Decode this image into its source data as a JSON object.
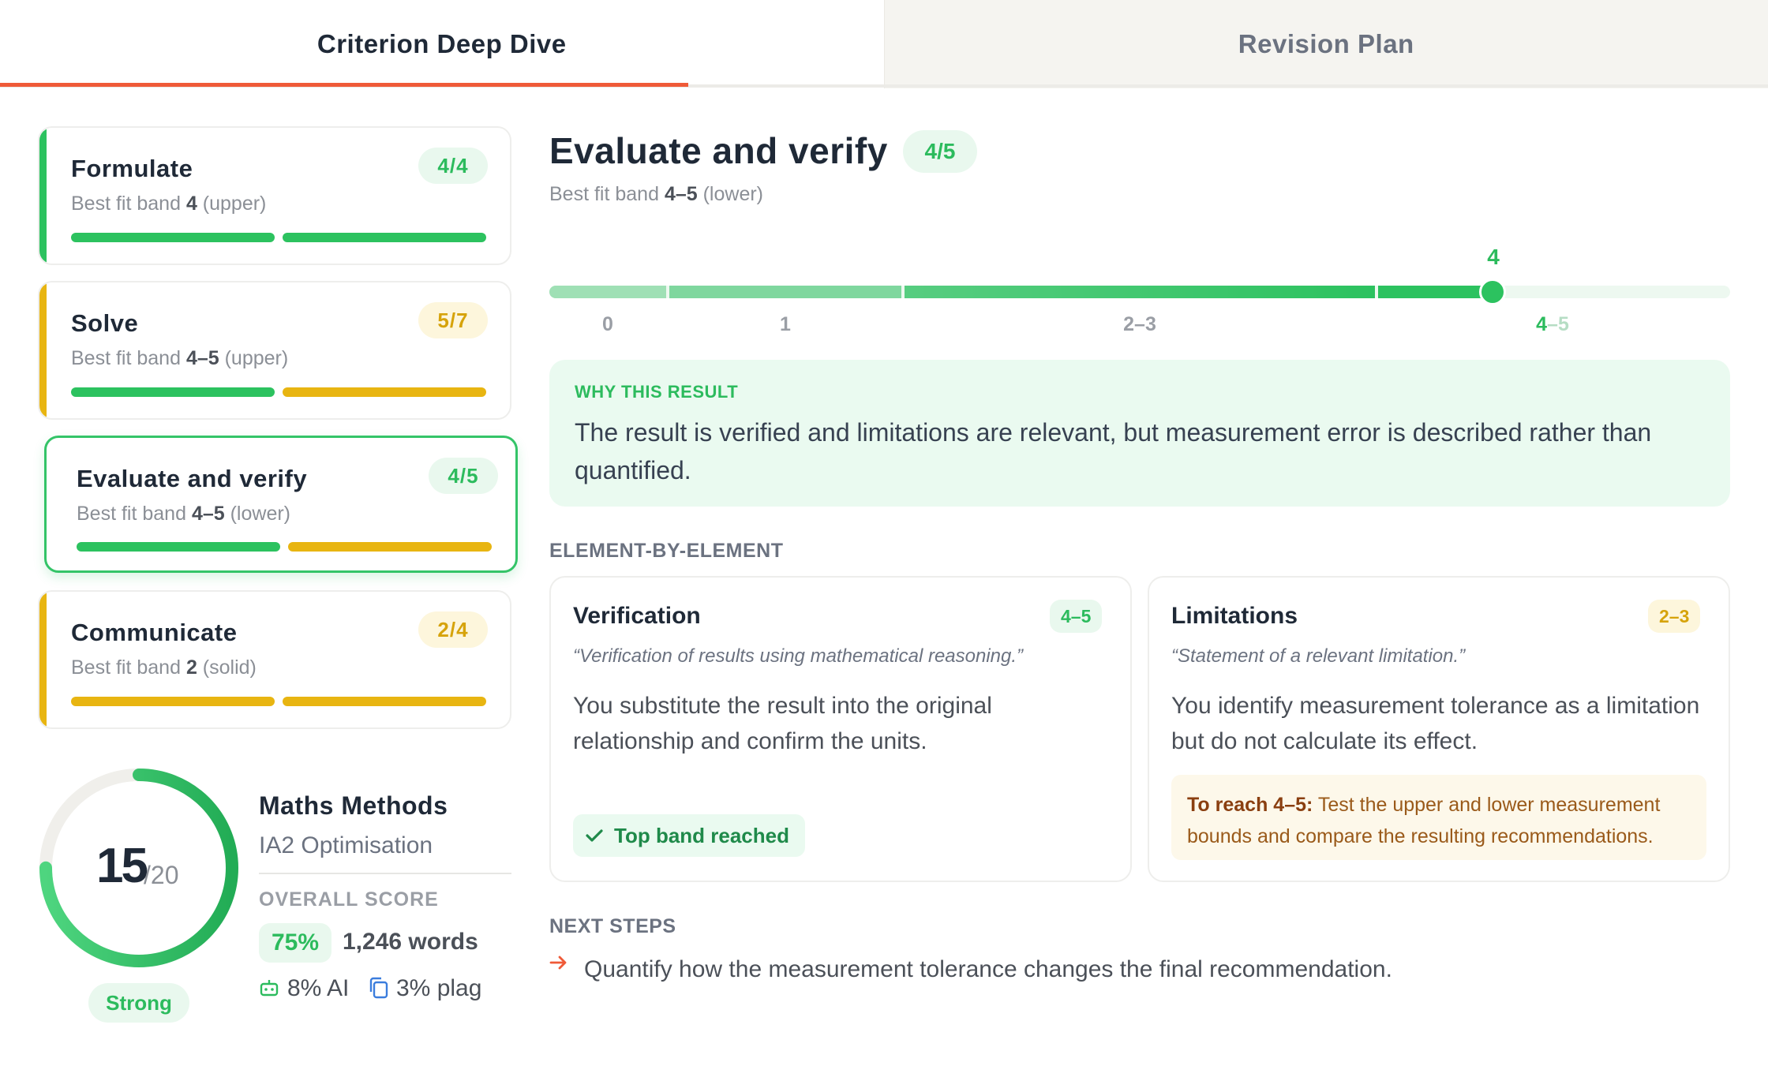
{
  "tabs": [
    {
      "label": "Criterion Deep Dive",
      "active": true
    },
    {
      "label": "Revision Plan",
      "active": false
    }
  ],
  "criteria": [
    {
      "title": "Formulate",
      "score": "4/4",
      "band_prefix": "Best fit band ",
      "band": "4",
      "band_suffix": " (upper)",
      "color": "green"
    },
    {
      "title": "Solve",
      "score": "5/7",
      "band_prefix": "Best fit band ",
      "band": "4–5",
      "band_suffix": " (upper)",
      "color": "amber"
    },
    {
      "title": "Evaluate and verify",
      "score": "4/5",
      "band_prefix": "Best fit band ",
      "band": "4–5",
      "band_suffix": " (lower)",
      "color": "green",
      "selected": true
    },
    {
      "title": "Communicate",
      "score": "2/4",
      "band_prefix": "Best fit band ",
      "band": "2",
      "band_suffix": " (solid)",
      "color": "amber"
    }
  ],
  "summary": {
    "score": "15",
    "score_total": "/20",
    "score_fraction": 0.75,
    "rating": "Strong",
    "subject": "Maths Methods",
    "assessment": "IA2 Optimisation",
    "overall_label": "OVERALL SCORE",
    "percent": "75%",
    "words": "1,246 words",
    "ai": "8% AI",
    "plag": "3% plag"
  },
  "detail": {
    "title": "Evaluate and verify",
    "score": "4/5",
    "band_prefix": "Best fit band ",
    "band": "4–5",
    "band_suffix": " (lower)",
    "scale": {
      "ticks": [
        "0",
        "1",
        "2–3"
      ],
      "last_tick_a": "4",
      "last_tick_sep": "–",
      "last_tick_b": "5",
      "marker": "4",
      "marker_position_fraction": 0.8
    },
    "why_label": "WHY THIS RESULT",
    "why_text": "The result is verified and limitations are relevant, but measurement error is described rather than quantified.",
    "elements_label": "ELEMENT-BY-ELEMENT",
    "elements": [
      {
        "title": "Verification",
        "band": "4–5",
        "quote": "“Verification of results using mathematical reasoning.”",
        "body": "You substitute the result into the original relationship and confirm the units.",
        "status": "Top band reached"
      },
      {
        "title": "Limitations",
        "band": "2–3",
        "quote": "“Statement of a relevant limitation.”",
        "body": "You identify measurement tolerance as a limitation but do not calculate its effect.",
        "reach_label": "To reach 4–5:",
        "reach_text": " Test the upper and lower measurement bounds and compare the resulting recommendations."
      }
    ],
    "next_label": "NEXT STEPS",
    "next_steps": [
      "Quantify how the measurement tolerance changes the final recommendation."
    ]
  },
  "colors": {
    "accent_tab": "#ef5a38",
    "green": "#2cc25f",
    "amber": "#e8b511"
  }
}
